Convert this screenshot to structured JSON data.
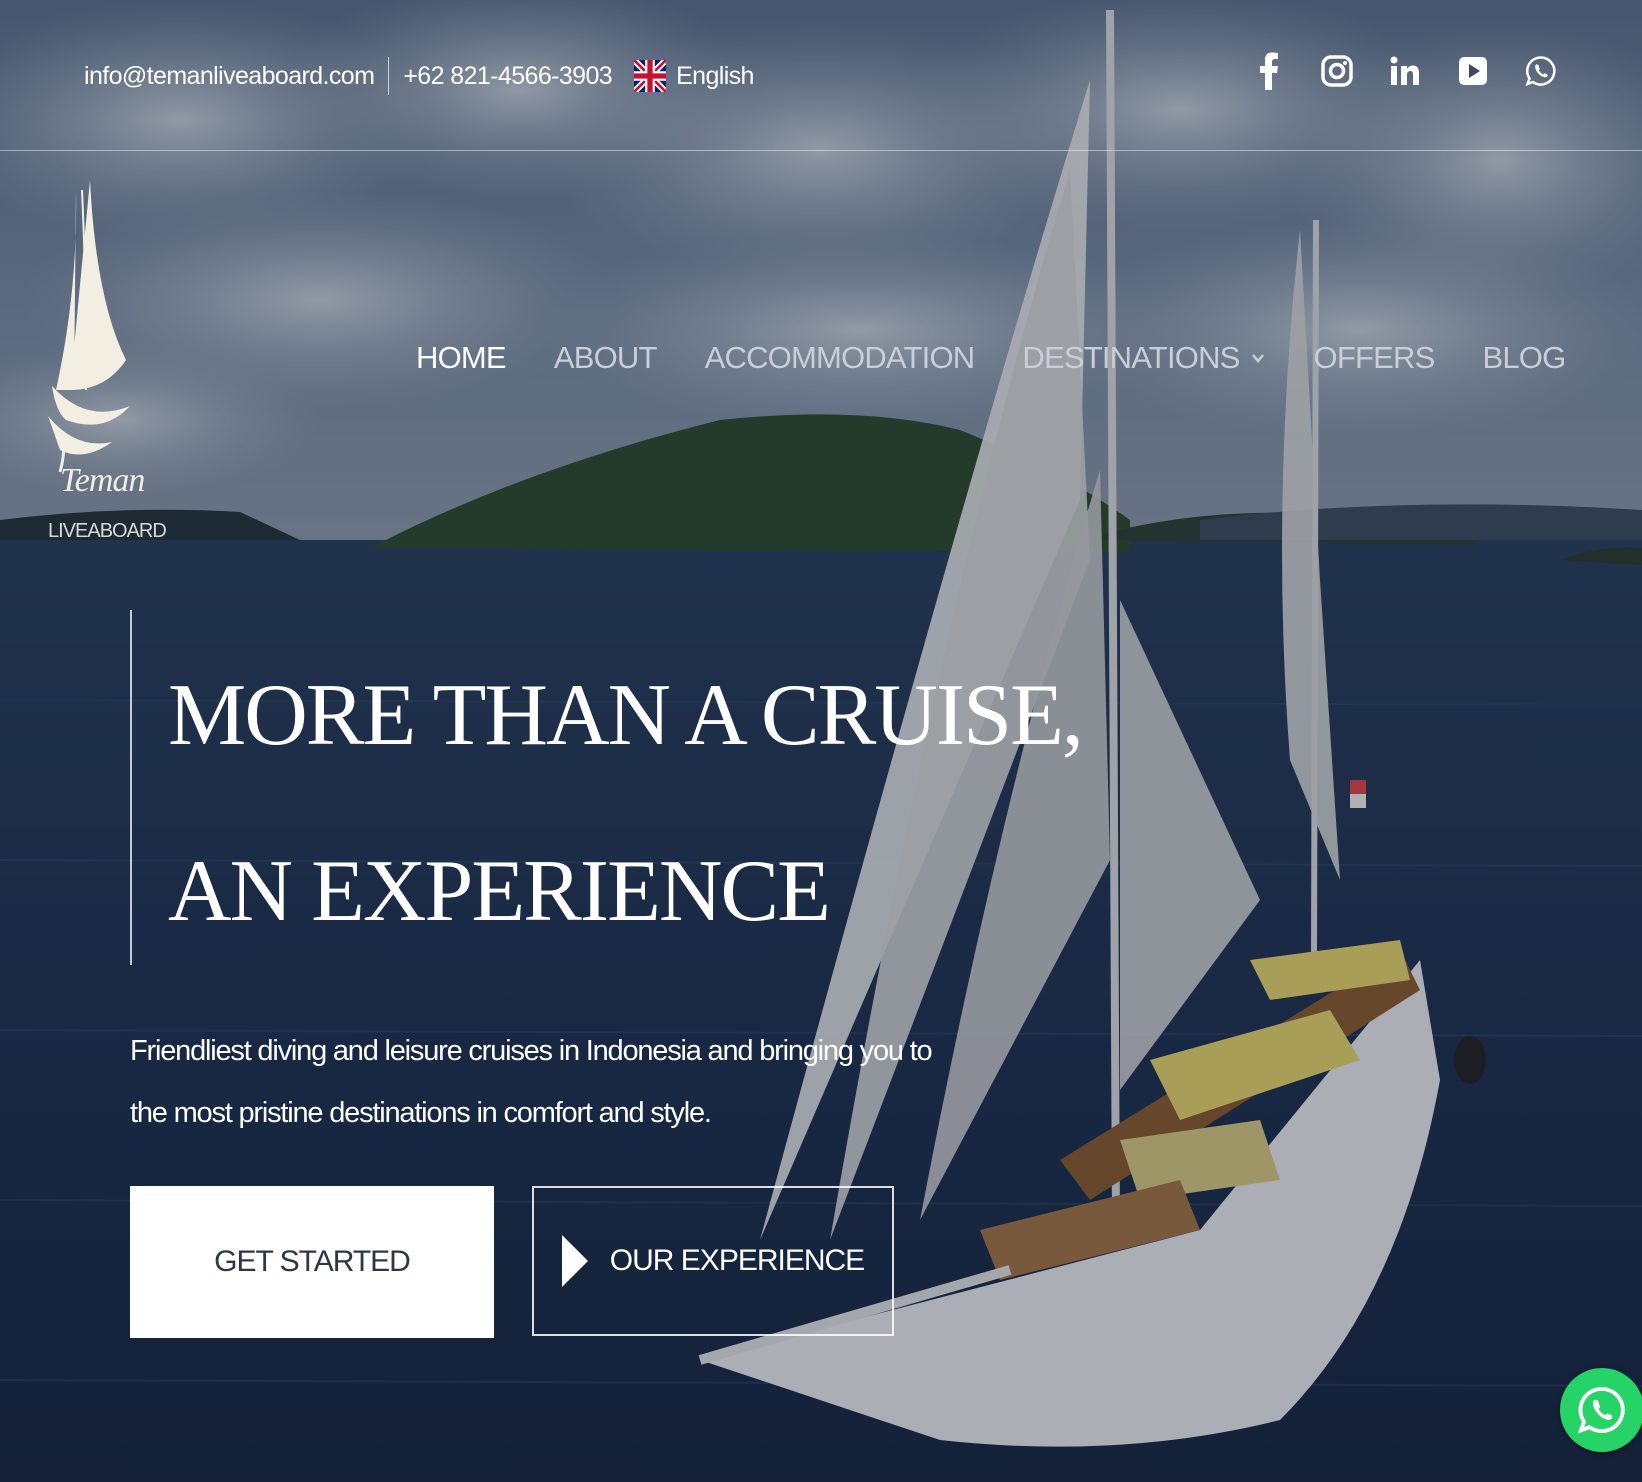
{
  "topbar": {
    "email": "info@temanliveaboard.com",
    "phone": "+62 821-4566-3903",
    "language": "English"
  },
  "social": {
    "icons": [
      "facebook-icon",
      "instagram-icon",
      "linkedin-icon",
      "youtube-icon",
      "whatsapp-icon"
    ]
  },
  "logo": {
    "name": "Teman",
    "tagline": "LIVEABOARD"
  },
  "nav": {
    "items": [
      {
        "label": "HOME",
        "active": true
      },
      {
        "label": "ABOUT"
      },
      {
        "label": "ACCOMMODATION"
      },
      {
        "label": "DESTINATIONS",
        "has_dropdown": true
      },
      {
        "label": "OFFERS"
      },
      {
        "label": "BLOG"
      }
    ]
  },
  "hero": {
    "headline_line1": "MORE THAN A CRUISE,",
    "headline_line2": "AN EXPERIENCE",
    "description": "Friendliest diving and leisure cruises in Indonesia and bringing you to the most pristine destinations in comfort and style.",
    "primary_button": "GET STARTED",
    "secondary_button": "OUR EXPERIENCE"
  },
  "colors": {
    "whatsapp_green": "#25d366",
    "button_text": "#2d3646",
    "sea": "#1c2c44"
  }
}
